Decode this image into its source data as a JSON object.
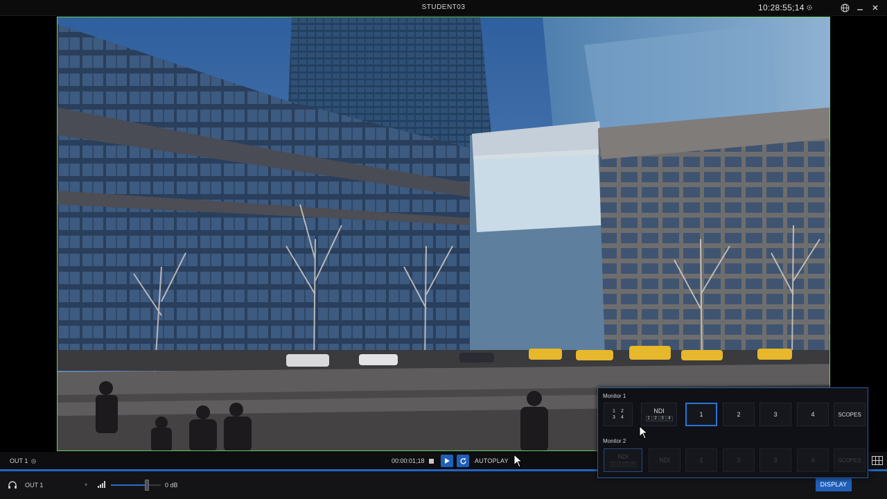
{
  "window": {
    "title": "STUDENT03",
    "clock": "10:28:55;14"
  },
  "transport": {
    "output_label": "OUT 1",
    "timecode": "00:00:01;18",
    "autoplay_label": "AUTOPLAY"
  },
  "audio": {
    "output_select": "OUT 1",
    "volume_label": "0 dB",
    "volume_level": 0.72
  },
  "monitor_panel": {
    "monitor1": {
      "label": "Monitor 1",
      "quad_labels": [
        "1",
        "2",
        "3",
        "4"
      ],
      "ndi_label": "NDI",
      "ndi_subs": [
        "1",
        "2",
        "3",
        "4"
      ],
      "buttons": [
        "1",
        "2",
        "3",
        "4"
      ],
      "scopes_label": "SCOPES",
      "selected": "1"
    },
    "monitor2": {
      "label": "Monitor 2",
      "ndi_label": "NDI",
      "ndi_subs": [
        "1",
        "2",
        "3",
        "4"
      ],
      "ndi2_label": "NDI",
      "buttons": [
        "1",
        "2",
        "3",
        "4"
      ],
      "scopes_label": "SCOPES"
    }
  },
  "display_button": "DISPLAY",
  "colors": {
    "accent": "#1f5fb8",
    "viewport_border": "#6fd36a",
    "background": "#000000"
  },
  "icons": [
    "gear-icon",
    "globe-icon",
    "minimize-icon",
    "close-icon",
    "stop-icon",
    "play-icon",
    "loop-icon",
    "headphones-icon",
    "signal-icon",
    "layout-icon"
  ]
}
